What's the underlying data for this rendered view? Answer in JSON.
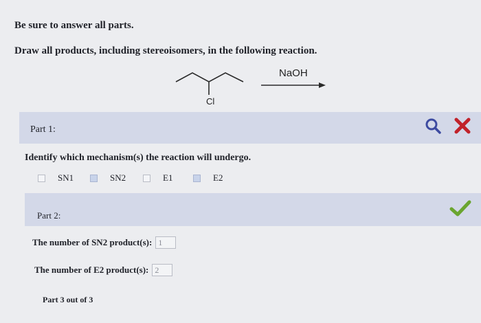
{
  "instructions": {
    "line1": "Be sure to answer all parts.",
    "line2": "Draw all products, including stereoisomers, in the following reaction."
  },
  "reaction": {
    "substituent": "Cl",
    "reagent": "NaOH"
  },
  "part1": {
    "label": "Part 1:",
    "question": "Identify which mechanism(s) the reaction will undergo.",
    "options": [
      {
        "label": "SN1",
        "checked": false
      },
      {
        "label": "SN2",
        "checked": true
      },
      {
        "label": "E1",
        "checked": false
      },
      {
        "label": "E2",
        "checked": true
      }
    ],
    "icons": [
      "search-icon",
      "close-icon"
    ]
  },
  "part2": {
    "label": "Part 2:",
    "q_sn2": "The number of SN2 product(s):",
    "a_sn2": "1",
    "q_e2": "The number of E2 product(s):",
    "a_e2": "2",
    "status_icon": "check-icon",
    "status_color": "#6aa52f"
  },
  "part3": {
    "label": "Part 3 out of 3"
  }
}
